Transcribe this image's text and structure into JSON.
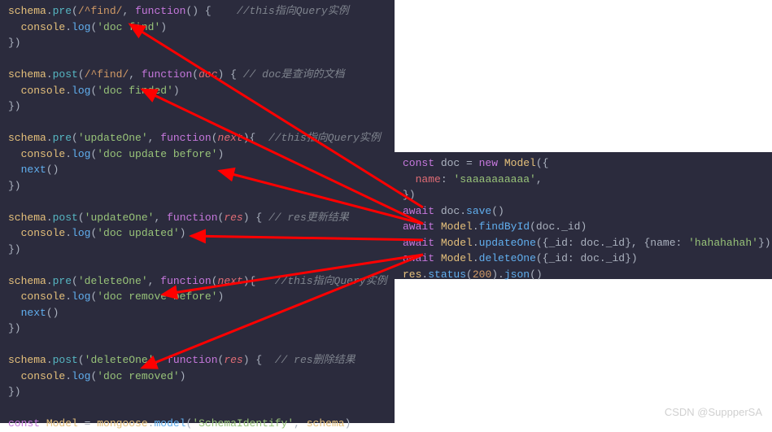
{
  "left": {
    "l1": "schema.pre(/^find/, function() {    //this指向Query实例",
    "l2": "  console.log('doc find')",
    "l3": "})",
    "l4": "",
    "l5": "schema.post(/^find/, function(doc) { // doc是查询的文档",
    "l6": "  console.log('doc finded')",
    "l7": "})",
    "l8": "",
    "l9": "schema.pre('updateOne', function(next){  //this指向Query实例",
    "l10": "  console.log('doc update before')",
    "l11": "  next()",
    "l12": "})",
    "l13": "",
    "l14": "schema.post('updateOne', function(res) { // res更新结果",
    "l15": "  console.log('doc updated')",
    "l16": "})",
    "l17": "",
    "l18": "schema.pre('deleteOne', function(next){   //this指向Query实例",
    "l19": "  console.log('doc remove before')",
    "l20": "  next()",
    "l21": "})",
    "l22": "",
    "l23": "schema.post('deleteOne', function(res) {  // res删除结果",
    "l24": "  console.log('doc removed')",
    "l25": "})",
    "l26": "",
    "l27": "const Model = mongoose.model('SchemaIdentify', schema)"
  },
  "right": {
    "r1": "const doc = new Model({",
    "r2": "  name: 'saaaaaaaaaa',",
    "r3": "})",
    "r4": "await doc.save()",
    "r5": "await Model.findById(doc._id)",
    "r6": "await Model.updateOne({_id: doc._id}, {name: 'hahahahah'})",
    "r7": "await Model.deleteOne({_id: doc._id})",
    "r8": "res.status(200).json()"
  },
  "watermark": "CSDN @SuppperSA"
}
